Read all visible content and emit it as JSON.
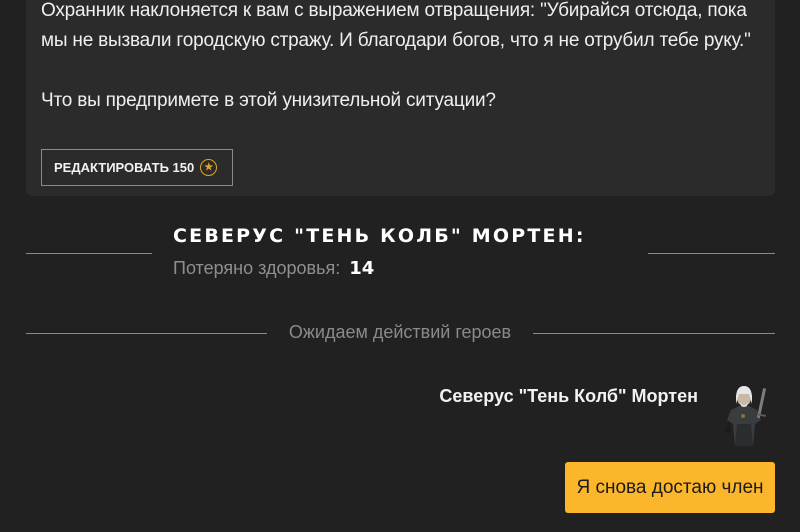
{
  "story": {
    "paragraph1": "Охранник наклоняется к вам с выражением отвращения: \"Убирайся отсюда, пока мы не вызвали городскую стражу. И благодари богов, что я не отрубил тебе руку.\"",
    "paragraph2": "Что вы предпримете в этой унизительной ситуации?"
  },
  "edit_button": {
    "label": "РЕДАКТИРОВАТЬ 150",
    "icon": "coin-star-icon",
    "icon_color": "#e0a52b"
  },
  "hero": {
    "name": "Северус \"Тень Колб\" Мортен:",
    "health_label": "Потеряно здоровья:",
    "health_value": "14"
  },
  "status": {
    "waiting": "Ожидаем действий героев"
  },
  "player": {
    "name": "Северус \"Тень Колб\" Мортен",
    "avatar": "hero-avatar"
  },
  "action_button": {
    "label": "Я снова достаю член",
    "color": "#fbb62b"
  },
  "colors": {
    "background": "#212121",
    "card": "#2b2b2b",
    "accent": "#fbb62b"
  }
}
